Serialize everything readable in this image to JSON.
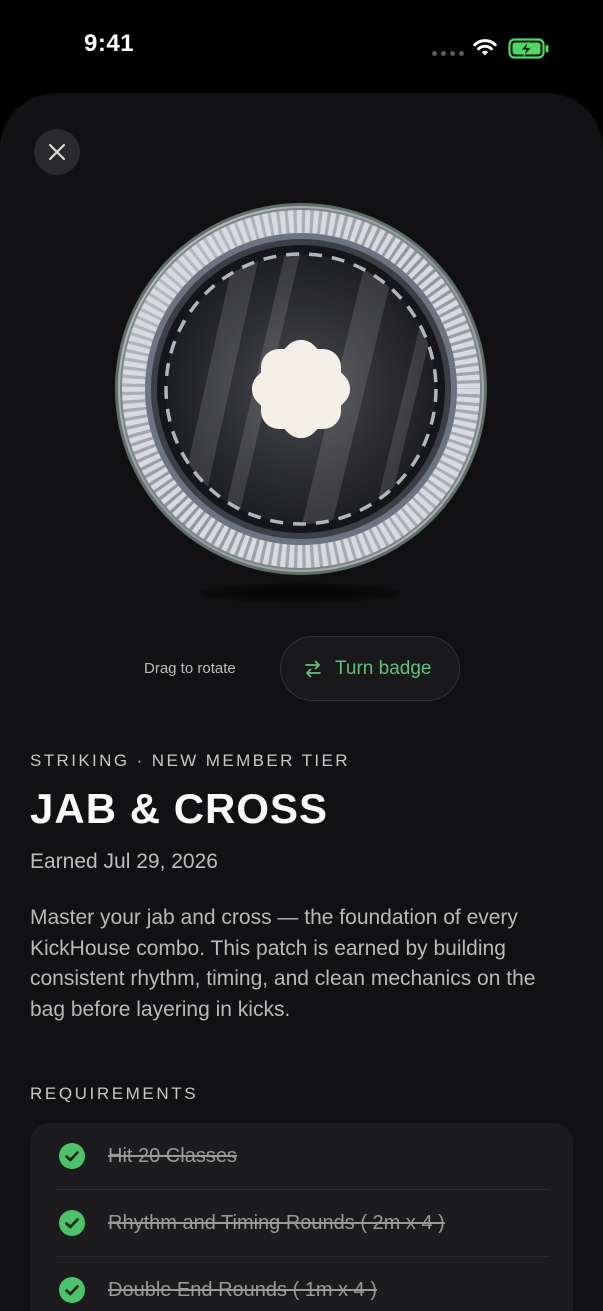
{
  "status_bar": {
    "time": "9:41"
  },
  "colors": {
    "accent": "#5ec27a",
    "background": "#111113",
    "battery": "#4cd964"
  },
  "icons": {
    "close": "close-icon",
    "badge_center": "flower-emblem-icon",
    "turn": "swap-arrows-icon",
    "check": "check-circle-icon"
  },
  "badge": {
    "hint": "Drag to rotate",
    "turn_label": "Turn badge"
  },
  "details": {
    "eyebrow": "STRIKING · NEW MEMBER TIER",
    "title": "JAB & CROSS",
    "earned": "Earned Jul 29, 2026",
    "description": "Master your jab and cross — the foundation of every KickHouse combo. This patch is earned by building consistent rhythm, timing, and clean mechanics on the bag before layering in kicks."
  },
  "requirements": {
    "label": "REQUIREMENTS",
    "items": [
      {
        "text": "Hit 20 Classes",
        "done": true
      },
      {
        "text": "Rhythm and Timing Rounds ( 2m x 4 )",
        "done": true
      },
      {
        "text": "Double End Rounds ( 1m x 4 )",
        "done": true
      }
    ]
  }
}
